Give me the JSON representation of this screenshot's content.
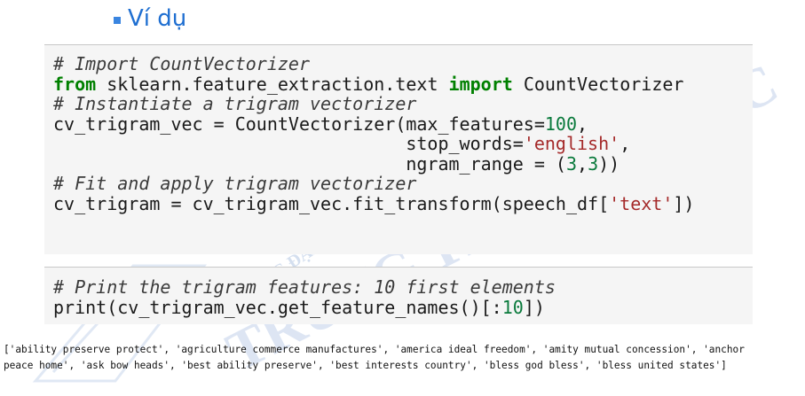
{
  "heading": "Ví dụ",
  "cell1": {
    "lines": [
      [
        {
          "t": "# Import CountVectorizer",
          "c": "cm"
        }
      ],
      [
        {
          "t": "from",
          "c": "kw"
        },
        {
          "t": " sklearn.feature_extraction.text "
        },
        {
          "t": "import",
          "c": "kw"
        },
        {
          "t": " CountVectorizer"
        }
      ],
      [
        {
          "t": "# Instantiate a trigram vectorizer",
          "c": "cm"
        }
      ],
      [
        {
          "t": "cv_trigram_vec = CountVectorizer(max_features="
        },
        {
          "t": "100",
          "c": "num"
        },
        {
          "t": ","
        }
      ],
      [
        {
          "t": "                                 stop_words="
        },
        {
          "t": "'english'",
          "c": "str"
        },
        {
          "t": ","
        }
      ],
      [
        {
          "t": "                                 ngram_range = ("
        },
        {
          "t": "3",
          "c": "num"
        },
        {
          "t": ","
        },
        {
          "t": "3",
          "c": "num"
        },
        {
          "t": "))"
        }
      ],
      [
        {
          "t": "# Fit and apply trigram vectorizer",
          "c": "cm"
        }
      ],
      [
        {
          "t": "cv_trigram = cv_trigram_vec.fit_transform(speech_df["
        },
        {
          "t": "'text'",
          "c": "str"
        },
        {
          "t": "])"
        }
      ]
    ]
  },
  "cell2": {
    "lines": [
      [
        {
          "t": "# Print the trigram features: 10 first elements",
          "c": "cm"
        }
      ],
      [
        {
          "t": "print(cv_trigram_vec.get_feature_names()[:"
        },
        {
          "t": "10",
          "c": "num"
        },
        {
          "t": "])"
        }
      ]
    ]
  },
  "output": {
    "lines": [
      "['ability preserve protect', 'agriculture commerce manufactures', 'america ideal freedom', 'amity mutual concession', 'anchor",
      "peace home', 'ask bow heads', 'best ability preserve', 'best interests country', 'bless god bless', 'bless united states']"
    ]
  },
  "watermark": {
    "line1": "TRƯỜNG ĐẠI HỌC KHOA HỌC TỰ NHIÊN",
    "line2": "TRUNG TÂM TIN HỌC",
    "color": "#a9bfe0"
  },
  "colors": {
    "heading": "#1f6fd1",
    "comment": "#3b3b3b",
    "keyword": "#008000",
    "string": "#a52a2a",
    "number": "#0a7a3c"
  }
}
